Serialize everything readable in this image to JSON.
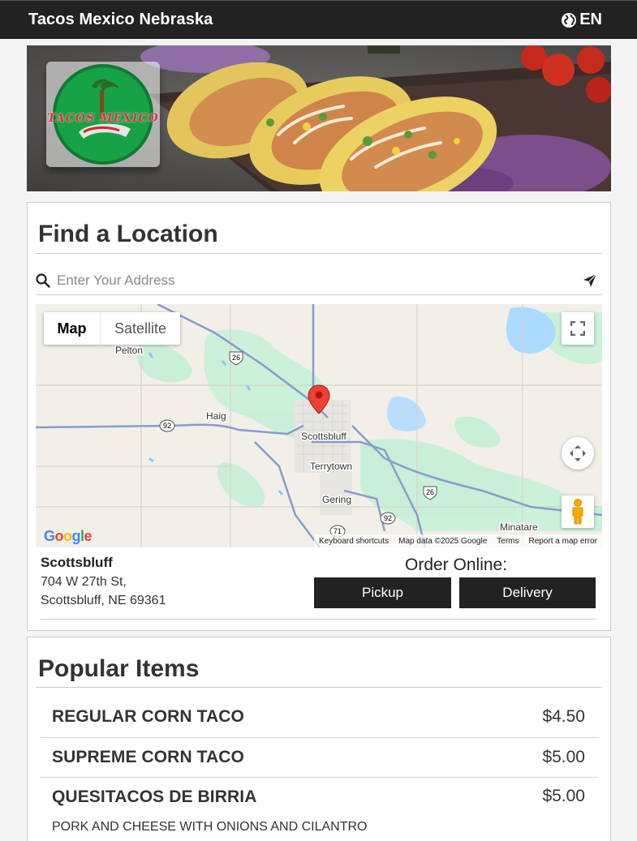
{
  "header": {
    "brand": "Tacos Mexico Nebraska",
    "language": "EN"
  },
  "hero": {
    "logo_text": "TACOS MEXICO"
  },
  "locator": {
    "title": "Find a Location",
    "search_placeholder": "Enter Your Address",
    "map": {
      "type_buttons": {
        "map": "Map",
        "satellite": "Satellite"
      },
      "active_type": "Map",
      "places": [
        "Pelton",
        "Haig",
        "Scottsbluff",
        "Terrytown",
        "Gering",
        "Minatare"
      ],
      "route_shields": [
        "26",
        "92",
        "26",
        "92",
        "71"
      ],
      "google_logo": "Google",
      "attribution": [
        "Keyboard shortcuts",
        "Map data ©2025 Google",
        "Terms",
        "Report a map error"
      ]
    },
    "store": {
      "name": "Scottsbluff",
      "address_line1": "704 W 27th St,",
      "address_line2": "Scottsbluff, NE 69361"
    },
    "order": {
      "label": "Order Online:",
      "pickup": "Pickup",
      "delivery": "Delivery"
    }
  },
  "popular": {
    "title": "Popular Items",
    "items": [
      {
        "name": "REGULAR CORN TACO",
        "price": "$4.50"
      },
      {
        "name": "SUPREME CORN TACO",
        "price": "$5.00"
      },
      {
        "name": "QUESITACOS DE BIRRIA",
        "price": "$5.00",
        "description": "PORK AND CHEESE WITH ONIONS AND CILANTRO"
      }
    ]
  },
  "colors": {
    "header_bg": "#222222",
    "button_bg": "#222222",
    "map_pin": "#ea4335",
    "map_water": "#aadaff",
    "map_park": "#c8f0d8"
  }
}
